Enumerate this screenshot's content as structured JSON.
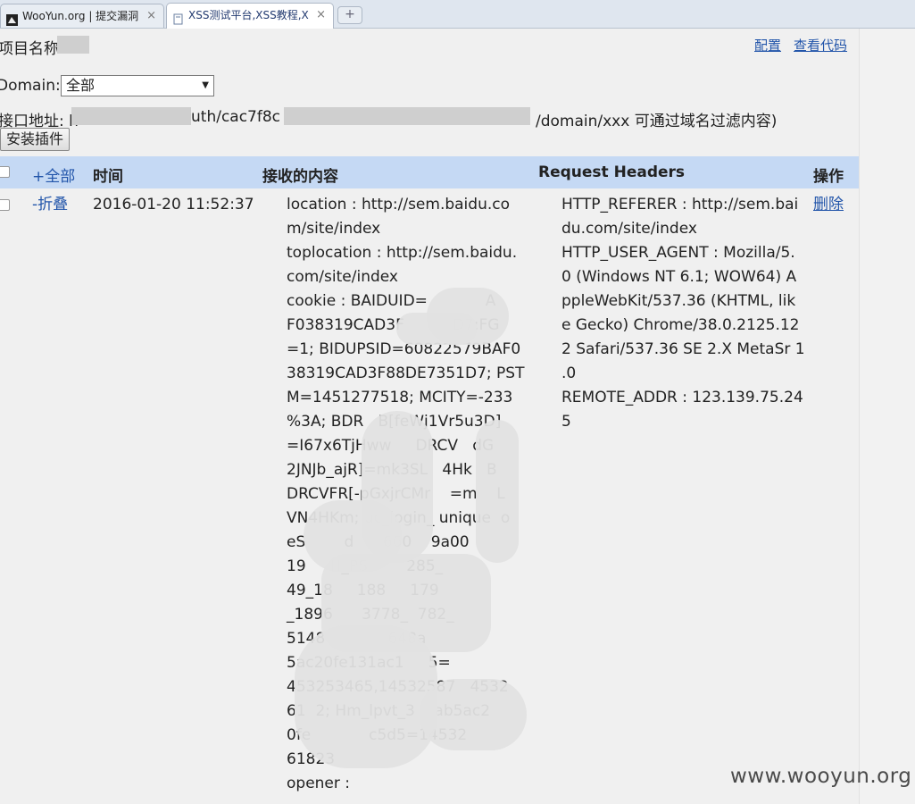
{
  "tabs": [
    {
      "label": "WooYun.org | 提交漏洞",
      "close": "×",
      "icon": "wooyun-favicon"
    },
    {
      "label": "XSS测试平台,XSS教程,X",
      "close": "×",
      "icon": "page-icon"
    }
  ],
  "new_tab": "+",
  "project": {
    "label": "项目名称"
  },
  "header_links": {
    "config": "配置",
    "view_code": "查看代码"
  },
  "domain": {
    "label": "Domain:",
    "selected": "全部"
  },
  "endpoint": {
    "label": "接口地址: h",
    "mid": "uth/cac7f8c",
    "suffix": "/domain/xxx 可通过域名过滤内容)"
  },
  "install_button": "安装插件",
  "table": {
    "headers": {
      "all": "+全部",
      "time": "时间",
      "content": "接收的内容",
      "headers": "Request Headers",
      "action": "操作"
    },
    "rows": [
      {
        "toggle": "-折叠",
        "time": "2016-01-20 11:52:37",
        "content_lines": [
          "location : http://sem.baidu.co",
          "m/site/index",
          "toplocation : http://sem.baidu.",
          "com/site/index",
          "cookie : BAIDUID=            A",
          "F038319CAD3F          D7:FG",
          "=1; BIDUPSID=60822579BAF0",
          "38319CAD3F88DE7351D7; PST",
          "M=1451277518; MCITY=-233",
          "%3A; BDR   B[feWj1Vr5u3D]",
          "=I67x6TjHww     DRCV   dG",
          "2JNJb_ajR]=mk3SL   4Hk   B",
          "DRCVFR[-pGxjrCMr    =m    L",
          "VN4HKm; uc_login_ unique  o",
          "eS        d      660    9a00",
          "19     H_PS        285_",
          "49_18     188     179",
          "_1896      3778_  782_",
          "5148             648a",
          "5ac20fe131ac1     5=",
          "453253465,14532587   4532",
          "61  2; Hm_lpvt_3    ab5ac2",
          "0fe            c5d5=14532",
          "61823",
          "opener :"
        ],
        "header_lines": [
          "HTTP_REFERER : http://sem.bai",
          "du.com/site/index",
          "HTTP_USER_AGENT : Mozilla/5.",
          "0 (Windows NT 6.1; WOW64) A",
          "ppleWebKit/537.36 (KHTML, lik",
          "e Gecko) Chrome/38.0.2125.12",
          "2 Safari/537.36 SE 2.X MetaSr 1",
          ".0",
          "REMOTE_ADDR : 123.139.75.24",
          "5"
        ],
        "action": "删除"
      }
    ]
  },
  "watermark": "www.wooyun.org"
}
